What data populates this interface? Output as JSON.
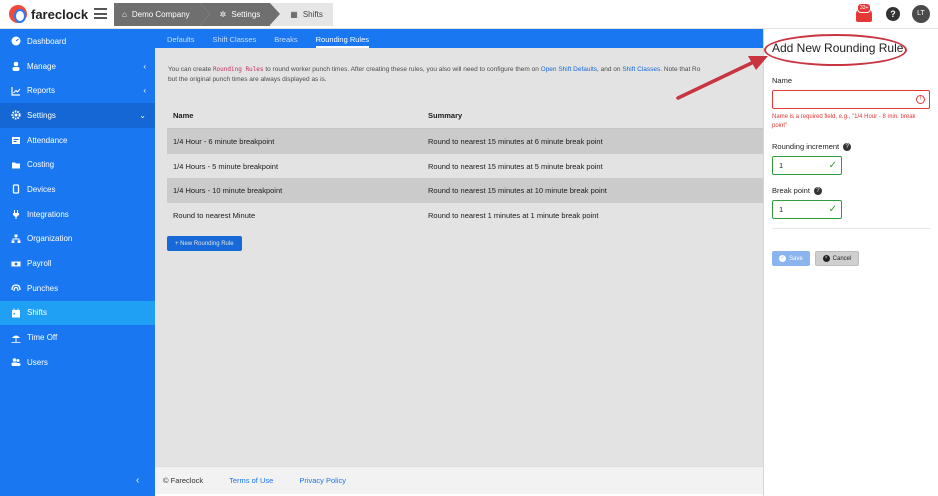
{
  "brand": {
    "name": "fareclock"
  },
  "breadcrumb": [
    {
      "label": "Demo Company",
      "icon": "home-icon"
    },
    {
      "label": "Settings",
      "icon": "gear-icon"
    },
    {
      "label": "Shifts",
      "icon": "calendar-icon"
    }
  ],
  "topbar": {
    "notification_count": "33+",
    "help": "?",
    "avatar_initials": "LT"
  },
  "sidebar": {
    "items": [
      {
        "label": "Dashboard",
        "icon": "dashboard-icon"
      },
      {
        "label": "Manage",
        "icon": "person-icon",
        "chevron": "‹"
      },
      {
        "label": "Reports",
        "icon": "chart-icon",
        "chevron": "‹"
      },
      {
        "label": "Settings",
        "icon": "gear-icon",
        "chevron": "⌄"
      },
      {
        "label": "Attendance",
        "icon": "attendance-icon"
      },
      {
        "label": "Costing",
        "icon": "folder-icon"
      },
      {
        "label": "Devices",
        "icon": "device-icon"
      },
      {
        "label": "Integrations",
        "icon": "plug-icon"
      },
      {
        "label": "Organization",
        "icon": "sitemap-icon"
      },
      {
        "label": "Payroll",
        "icon": "money-icon"
      },
      {
        "label": "Punches",
        "icon": "fingerprint-icon"
      },
      {
        "label": "Shifts",
        "icon": "calendar-icon"
      },
      {
        "label": "Time Off",
        "icon": "umbrella-icon"
      },
      {
        "label": "Users",
        "icon": "users-icon"
      }
    ],
    "collapse": "‹"
  },
  "tabs": [
    {
      "label": "Defaults"
    },
    {
      "label": "Shift Classes"
    },
    {
      "label": "Breaks"
    },
    {
      "label": "Rounding Rules"
    }
  ],
  "intro": {
    "t1": "You can create ",
    "code": "Rounding Rules",
    "t2": " to round worker punch times. After creating these rules, you also will need to configure them on ",
    "link1": "Open Shift Defaults",
    "t3": ", and on ",
    "link2": "Shift Classes",
    "t4": ". Note that Ro",
    "line2": "but the original punch times are always displayed as is."
  },
  "table": {
    "headers": [
      "Name",
      "Summary"
    ],
    "rows": [
      [
        "1/4 Hour - 6 minute breakpoint",
        "Round to nearest 15 minutes at 6 minute break point"
      ],
      [
        "1/4 Hours - 5 minute breakpoint",
        "Round to nearest 15 minutes at 5 minute break point"
      ],
      [
        "1/4 Hours - 10 minute breakpoint",
        "Round to nearest 15 minutes at 10 minute break point"
      ],
      [
        "Round to nearest Minute",
        "Round to nearest 1 minutes at 1 minute break point"
      ]
    ]
  },
  "new_button": "+ New Rounding Rule",
  "footer": {
    "copyright": "© Fareclock",
    "terms": "Terms of Use",
    "privacy": "Privacy Policy"
  },
  "panel": {
    "title": "Add New Rounding Rule",
    "name_label": "Name",
    "name_value": "",
    "name_error": "Name is a required field, e.g., \"1/4 Hour - 8 min. break point\"",
    "increment_label": "Rounding increment",
    "increment_value": "1",
    "breakpoint_label": "Break point",
    "breakpoint_value": "1",
    "save": "Save",
    "cancel": "Cancel"
  },
  "colors": {
    "primary": "#1977f2",
    "active": "#1fa0f5",
    "error": "#e53935",
    "success": "#2e9e3f",
    "annotation": "#c8343f"
  }
}
